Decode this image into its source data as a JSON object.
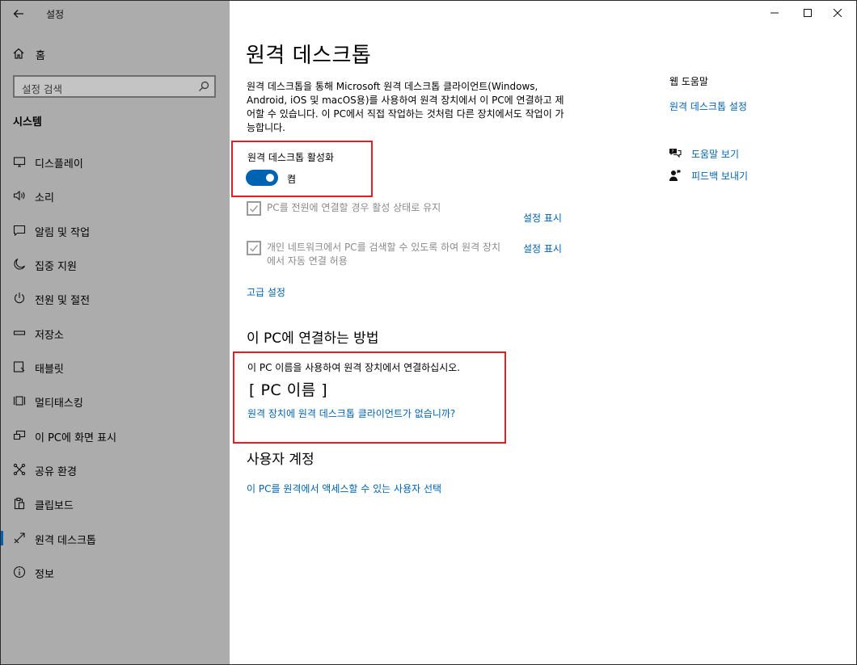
{
  "app": {
    "title": "설정"
  },
  "sidebar": {
    "home_label": "홈",
    "search_placeholder": "설정 검색",
    "section_title": "시스템",
    "items": [
      {
        "label": "디스플레이",
        "icon": "monitor-icon"
      },
      {
        "label": "소리",
        "icon": "speaker-icon"
      },
      {
        "label": "알림 및 작업",
        "icon": "notification-icon"
      },
      {
        "label": "집중 지원",
        "icon": "moon-icon"
      },
      {
        "label": "전원 및 절전",
        "icon": "power-icon"
      },
      {
        "label": "저장소",
        "icon": "storage-icon"
      },
      {
        "label": "태블릿",
        "icon": "tablet-icon"
      },
      {
        "label": "멀티태스킹",
        "icon": "multitasking-icon"
      },
      {
        "label": "이 PC에 화면 표시",
        "icon": "project-icon"
      },
      {
        "label": "공유 환경",
        "icon": "shared-experiences-icon"
      },
      {
        "label": "클립보드",
        "icon": "clipboard-icon"
      },
      {
        "label": "원격 데스크톱",
        "icon": "remote-desktop-icon",
        "active": true
      },
      {
        "label": "정보",
        "icon": "info-icon"
      }
    ]
  },
  "main": {
    "title": "원격 데스크톱",
    "description": "원격 데스크톱을 통해 Microsoft 원격 데스크톱 클라이언트(Windows, Android, iOS 및 macOS용)를 사용하여 원격 장치에서 이 PC에 연결하고 제어할 수 있습니다. 이 PC에서 직접 작업하는 것처럼 다른 장치에서도 작업이 가능합니다.",
    "toggle": {
      "label": "원격 데스크톱 활성화",
      "state": "켬",
      "on": true
    },
    "checkbox1": {
      "label": "PC를 전원에 연결할 경우 활성 상태로 유지",
      "link": "설정 표시",
      "checked": true
    },
    "checkbox2": {
      "label": "개인 네트워크에서 PC를 검색할 수 있도록 하여 원격 장치에서 자동 연결 허용",
      "link": "설정 표시",
      "checked": true
    },
    "advanced_link": "고급 설정",
    "connect": {
      "heading": "이 PC에 연결하는 방법",
      "text": "이 PC 이름을 사용하여 원격 장치에서 연결하십시오.",
      "pc_name": "[ PC 이름 ]",
      "client_link": "원격 장치에 원격 데스크톱 클라이언트가 없습니까?"
    },
    "accounts": {
      "heading": "사용자 계정",
      "link": "이 PC를 원격에서 액세스할 수 있는 사용자 선택"
    }
  },
  "help": {
    "title": "웹 도움말",
    "web_link": "원격 데스크톱 설정",
    "get_help": "도움말 보기",
    "feedback": "피드백 보내기"
  },
  "colors": {
    "accent": "#0063b1",
    "highlight": "#e31e24",
    "sidebar": "#acacac"
  }
}
